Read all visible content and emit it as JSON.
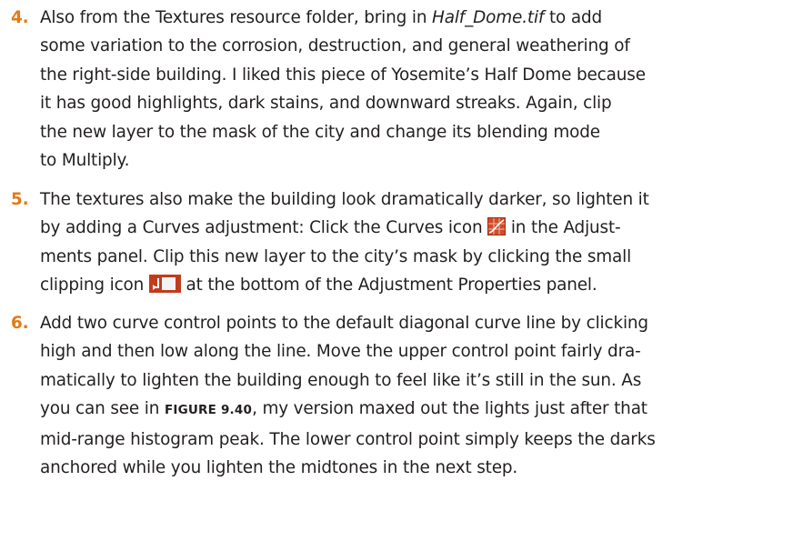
{
  "step4": {
    "number": "4.",
    "line1_a": "Also from the Textures resource folder, bring in ",
    "line1_file": "Half_Dome.tif",
    "line1_b": " to add",
    "line2": "some variation to the corrosion, destruction, and general weathering of",
    "line3": "the right-side building. I liked this piece of Yosemite’s Half Dome because",
    "line4": "it has good highlights, dark stains, and downward streaks. Again, clip",
    "line5": "the new layer to the mask of the city and change its blending mode",
    "line6": "to Multiply."
  },
  "step5": {
    "number": "5.",
    "line1": "The textures also make the building look dramatically darker, so lighten it",
    "line2_a": "by adding a Curves adjustment: Click the Curves icon ",
    "line2_icon": "curves-icon",
    "line2_b": " in the Adjust-",
    "line3": "ments panel. Clip this new layer to the city’s mask by clicking the small",
    "line4_a": "clipping icon ",
    "line4_icon": "clipping-icon",
    "line4_b": " at the bottom of the Adjustment Properties panel."
  },
  "step6": {
    "number": "6.",
    "line1": "Add two curve control points to the default diagonal curve line by clicking",
    "line2": "high and then low along the line. Move the upper control point fairly dra-",
    "line3": "matically to lighten the building enough to feel like it’s still in the sun. As",
    "line4_a": "you can see in ",
    "line4_ref": "FIGURE 9.40",
    "line4_b": ", my version maxed out the lights just after that",
    "line5": "mid-range histogram peak. The lower control point simply keeps the darks",
    "line6": "anchored while you lighten the midtones in the next step."
  },
  "colors": {
    "step_number": "#e07b17",
    "body_text": "#231f20",
    "curves_icon": "#d24a28",
    "clip_icon": "#c13c1c"
  }
}
